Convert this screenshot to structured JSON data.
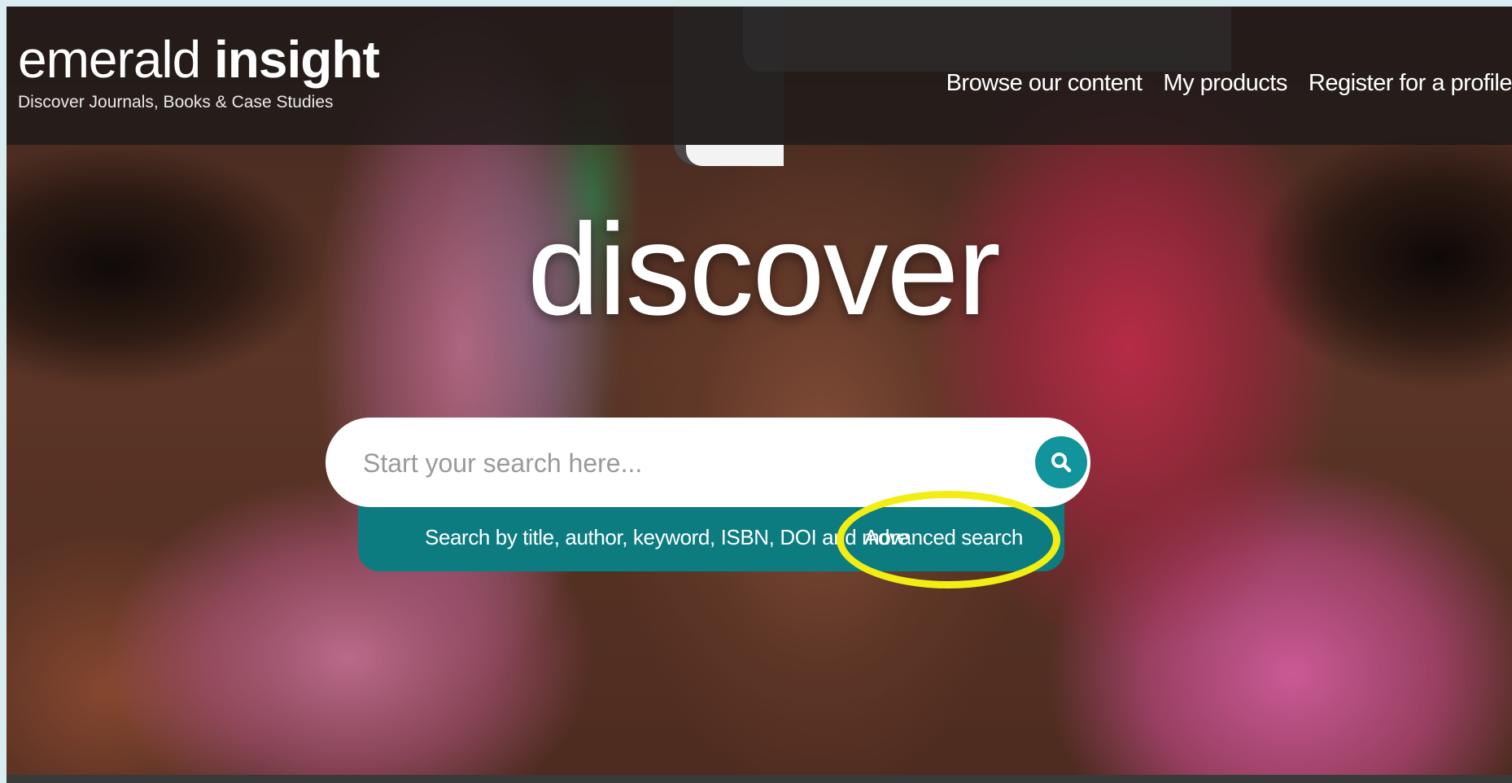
{
  "brand": {
    "name_part1": "emerald",
    "name_part2": "insight",
    "tagline": "Discover Journals, Books & Case Studies"
  },
  "nav": {
    "items": [
      {
        "label": "Browse our content"
      },
      {
        "label": "My products"
      },
      {
        "label": "Register for a profile"
      }
    ]
  },
  "hero": {
    "title": "discover"
  },
  "search": {
    "placeholder": "Start your search here...",
    "value": "",
    "button_icon": "search-icon",
    "hint": "Search by title, author, keyword, ISBN, DOI and more",
    "advanced_label": "Advanced search"
  },
  "colors": {
    "accent_teal": "#11949b",
    "hint_bar": "#0c7c80",
    "highlight": "#f2ee13"
  }
}
